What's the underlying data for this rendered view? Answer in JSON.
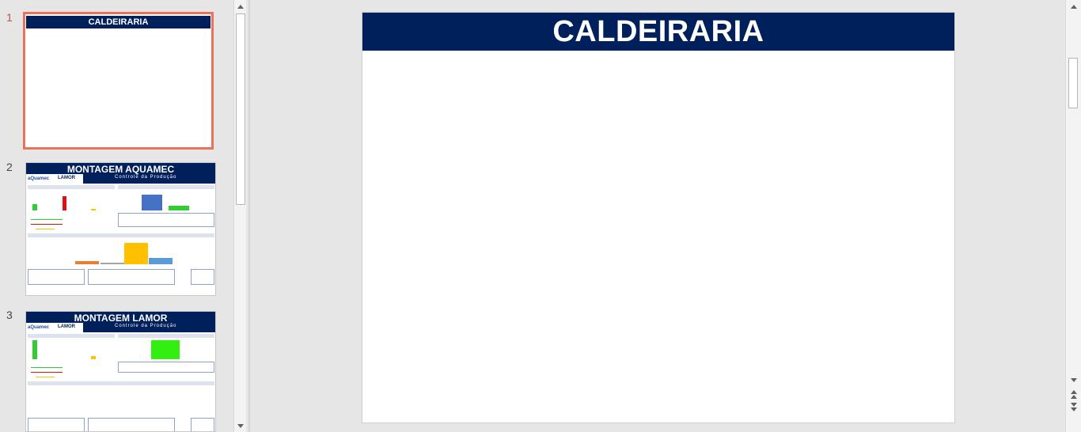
{
  "thumbnails": [
    {
      "number": "1",
      "title": "CALDEIRARIA",
      "selected": true
    },
    {
      "number": "2",
      "title": "MONTAGEM AQUAMEC",
      "subtitle": "Controle da Produção",
      "logo_left": "aQuamec",
      "logo_right": "LAMOR"
    },
    {
      "number": "3",
      "title": "MONTAGEM LAMOR",
      "subtitle": "Controle da Produção",
      "logo_left": "aQuamec",
      "logo_right": "LAMOR"
    }
  ],
  "slide": {
    "title": "CALDEIRARIA"
  },
  "colors": {
    "title_bar": "#00205b",
    "selected_border": "#e9735a",
    "active_number": "#c0504d"
  },
  "icons": {
    "scroll_up": "triangle-up-icon",
    "scroll_down": "triangle-down-icon",
    "prev_slide": "double-up-icon",
    "next_slide": "double-down-icon"
  }
}
